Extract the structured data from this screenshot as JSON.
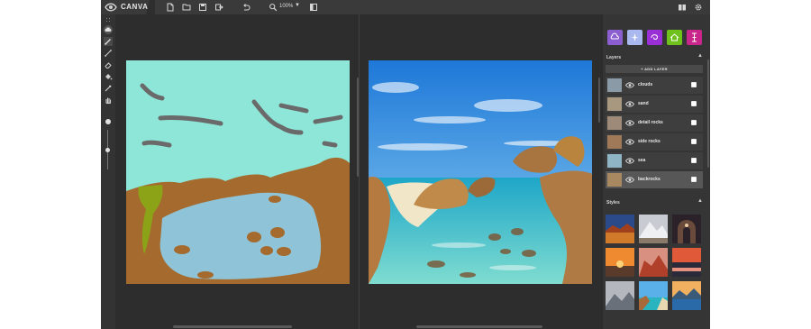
{
  "app": {
    "title": "CANVAS",
    "zoom": "100%"
  },
  "toolbar_top": {
    "icons": [
      "nvidia-logo",
      "new-file-icon",
      "open-folder-icon",
      "save-icon",
      "export-icon",
      "undo-icon",
      "zoom-icon",
      "zoom-dropdown-icon",
      "toggle-panel-icon",
      "book-icon",
      "gear-icon"
    ]
  },
  "tools": [
    "grip-icon",
    "cloud-icon",
    "brush-icon",
    "line-icon",
    "eraser-icon",
    "fill-icon",
    "eyedropper-icon",
    "hand-icon"
  ],
  "materials": [
    {
      "name": "clouds",
      "color": "#8b5fd0"
    },
    {
      "name": "sky",
      "color": "#aab8f0"
    },
    {
      "name": "swirl",
      "color": "#9a2fd6"
    },
    {
      "name": "house",
      "color": "#6ec21b"
    },
    {
      "name": "tree",
      "color": "#c8268a"
    }
  ],
  "layers_panel": {
    "title": "Layers",
    "add_label": "+ ADD LAYER",
    "items": [
      {
        "name": "clouds",
        "selected": false
      },
      {
        "name": "sand",
        "selected": false
      },
      {
        "name": "detail rocks",
        "selected": false
      },
      {
        "name": "side rocks",
        "selected": false
      },
      {
        "name": "sea",
        "selected": false
      },
      {
        "name": "backrocks",
        "selected": true
      }
    ]
  },
  "styles_panel": {
    "title": "Styles",
    "thumbs": [
      "style-desert-sunset",
      "style-snowy-peak",
      "style-dark-arch",
      "style-orange-sunset",
      "style-red-canyon",
      "style-pink-lake",
      "style-misty-mountains",
      "style-tropical-coast",
      "style-alpine-lake"
    ]
  },
  "colors": {
    "segmentation_sky": "#8de6d8",
    "segmentation_rock": "#a56a2e",
    "segmentation_water": "#8fc4d8",
    "segmentation_grass": "#8ca318",
    "segmentation_cloud": "#6a6a6a"
  }
}
